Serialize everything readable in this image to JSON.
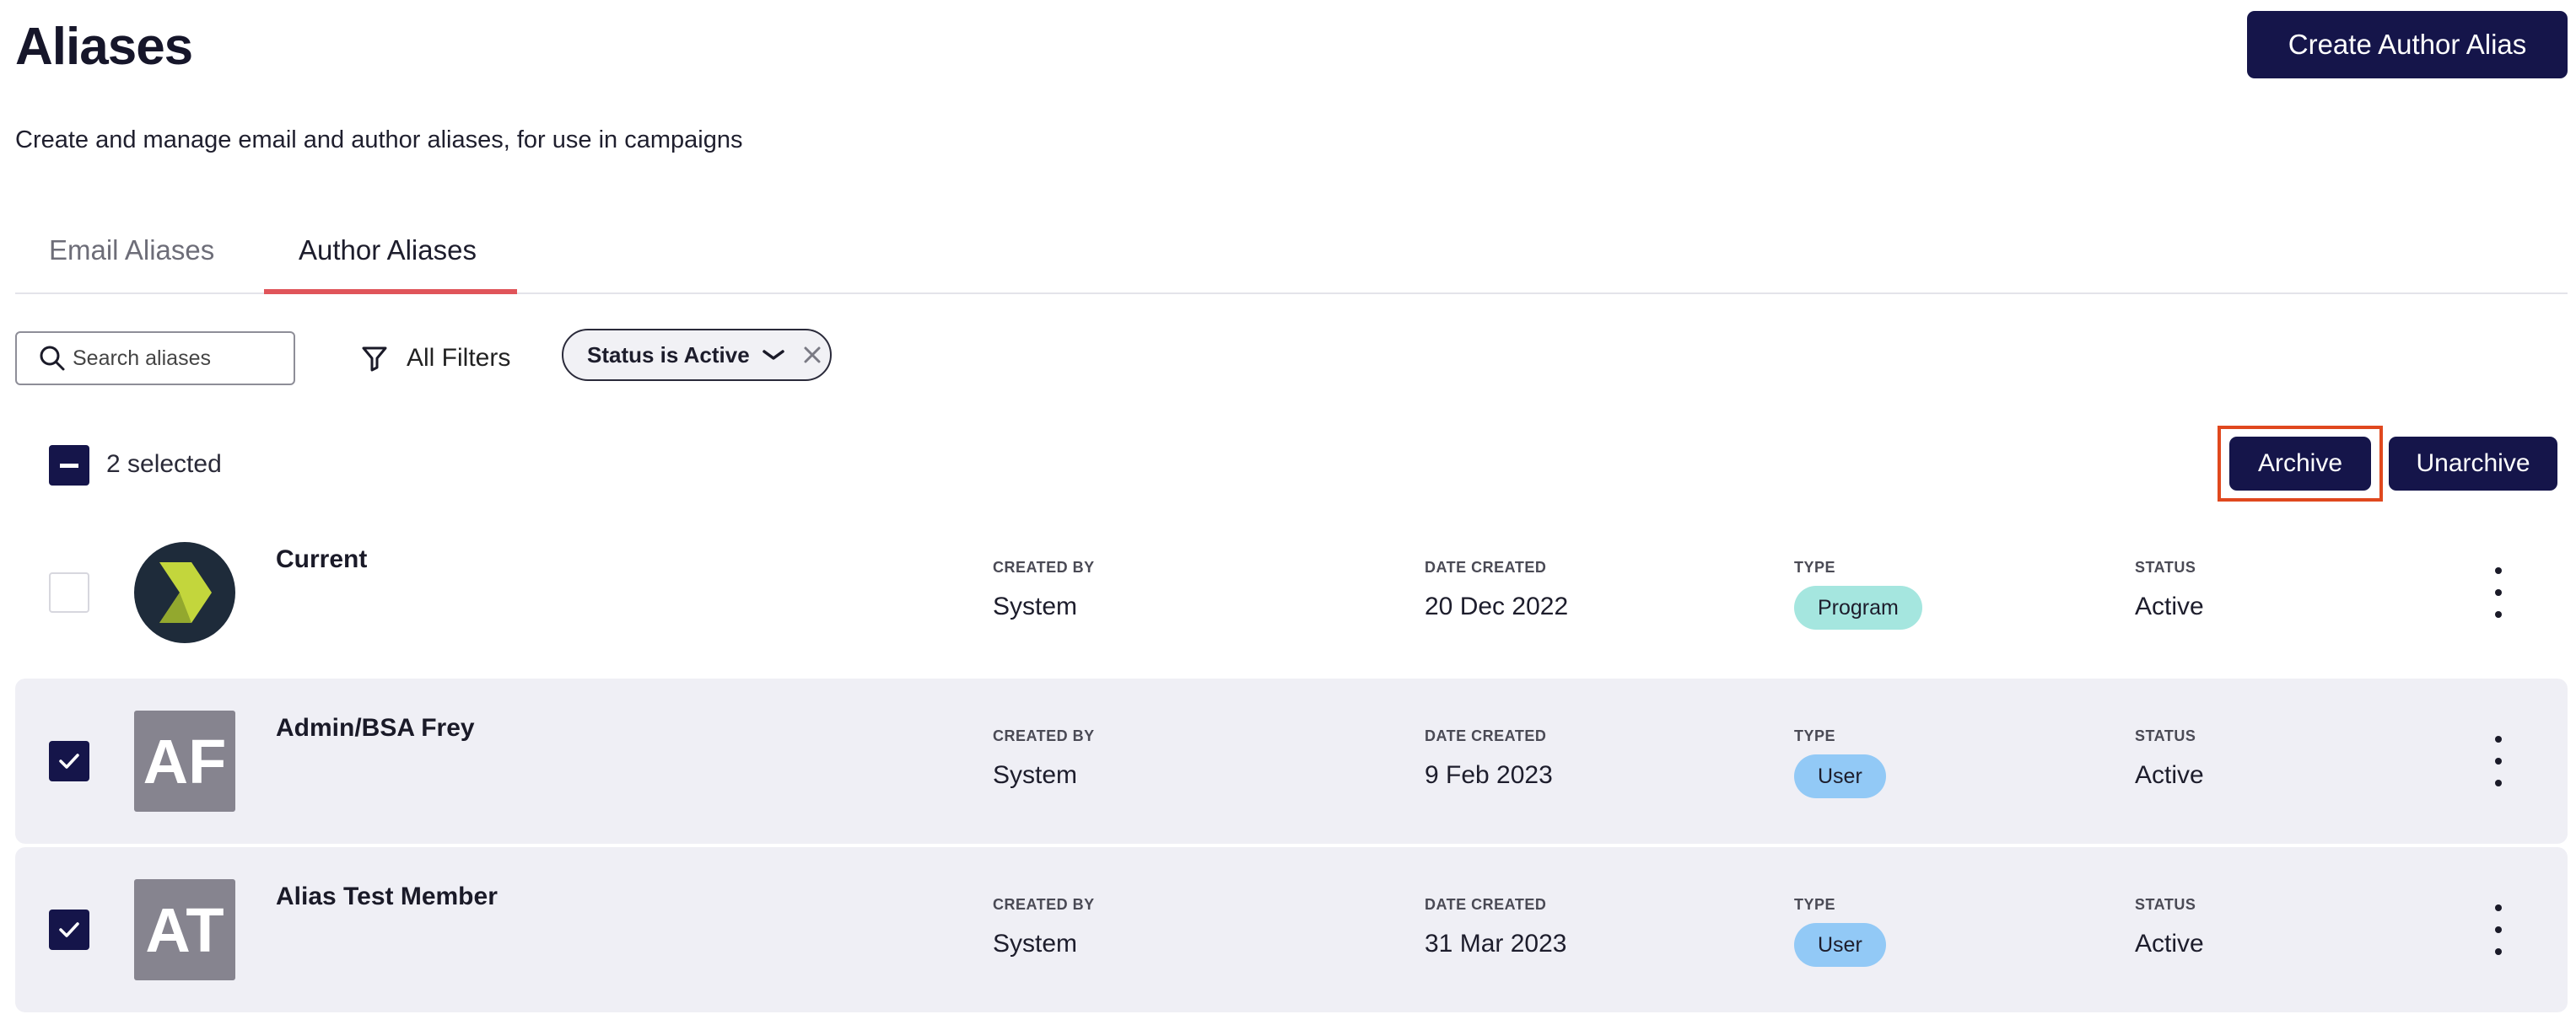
{
  "header": {
    "title": "Aliases",
    "subtitle": "Create and manage email and author aliases, for use in campaigns",
    "create_button": "Create Author Alias"
  },
  "tabs": [
    {
      "label": "Email Aliases",
      "active": false
    },
    {
      "label": "Author Aliases",
      "active": true
    }
  ],
  "toolbar": {
    "search_placeholder": "Search aliases",
    "all_filters_label": "All Filters",
    "filter_chip_label": "Status is Active"
  },
  "bulk_actions": {
    "selected_text": "2 selected",
    "archive_label": "Archive",
    "unarchive_label": "Unarchive"
  },
  "columns": {
    "created_by": "CREATED BY",
    "date_created": "DATE CREATED",
    "type": "TYPE",
    "status": "STATUS"
  },
  "rows": [
    {
      "name": "Current",
      "avatar_type": "logo",
      "avatar_icon": "chevron-logo-icon",
      "created_by": "System",
      "date_created": "20 Dec 2022",
      "type": "Program",
      "status": "Active",
      "selected": false
    },
    {
      "name": "Admin/BSA Frey",
      "avatar_type": "initials",
      "initials": "AF",
      "created_by": "System",
      "date_created": "9 Feb 2023",
      "type": "User",
      "status": "Active",
      "selected": true
    },
    {
      "name": "Alias Test Member",
      "avatar_type": "initials",
      "initials": "AT",
      "created_by": "System",
      "date_created": "31 Mar 2023",
      "type": "User",
      "status": "Active",
      "selected": true
    }
  ],
  "colors": {
    "primary": "#15154a",
    "tab_accent": "#e0545a",
    "highlight_outline": "#e0481e",
    "selected_row_bg": "#efeff5",
    "badge_program": "#a5e6df",
    "badge_user": "#92c9f6",
    "avatar_initials_bg": "#86848f",
    "logo_bg": "#1e2b3a",
    "logo_accent": "#c3d63c"
  }
}
